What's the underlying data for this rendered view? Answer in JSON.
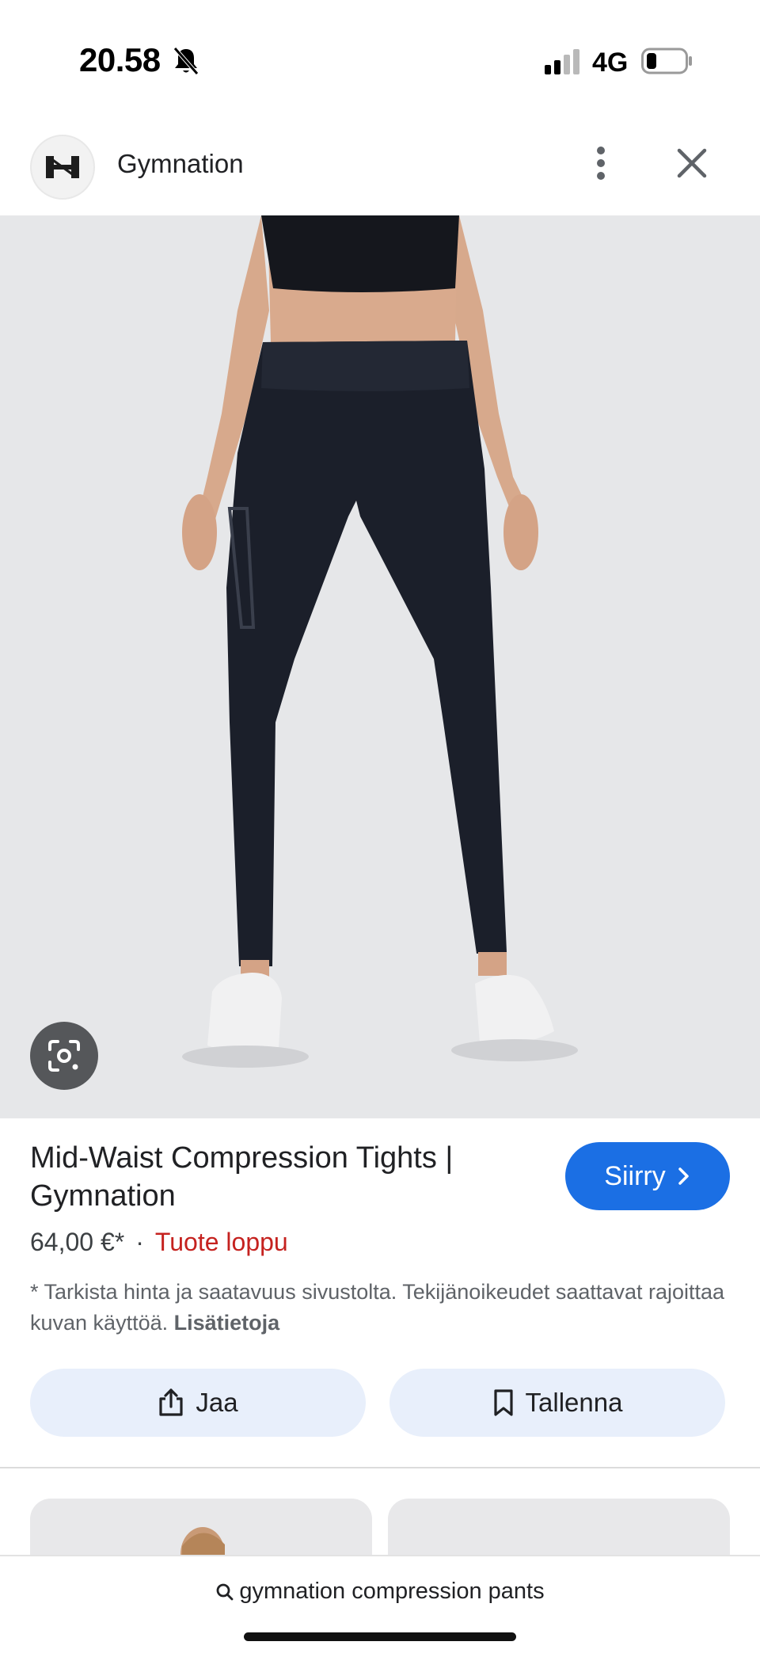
{
  "status_bar": {
    "time": "20.58",
    "network": "4G",
    "icons": [
      "bell-muted-icon",
      "signal-icon",
      "battery-icon"
    ]
  },
  "header": {
    "site_name": "Gymnation",
    "logo": "gymnation-logo",
    "icons": [
      "more-vert-icon",
      "close-icon"
    ]
  },
  "product": {
    "title": "Mid-Waist Compression Tights | Gymnation",
    "go_label": "Siirry",
    "price": "64,00 €*",
    "separator": "·",
    "availability": "Tuote loppu",
    "disclaimer_text": "* Tarkista hinta ja saatavuus sivustolta. Tekijänoikeudet saattavat rajoittaa kuvan käyttöä.",
    "more_info_link": "Lisätietoja",
    "image_icon": "lens-search-icon"
  },
  "actions": {
    "share_label": "Jaa",
    "save_label": "Tallenna"
  },
  "search": {
    "query": "gymnation compression pants"
  },
  "colors": {
    "accent": "#1b6fe4",
    "out_of_stock": "#c5221f",
    "action_bg": "#e8effb",
    "image_bg": "#e6e7e9"
  }
}
